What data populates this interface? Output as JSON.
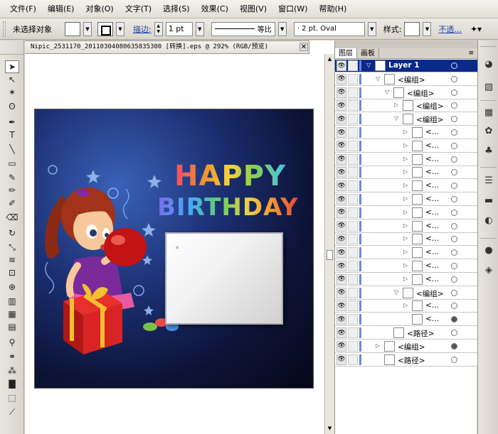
{
  "menubar": {
    "items": [
      "文件(F)",
      "编辑(E)",
      "对象(O)",
      "文字(T)",
      "选择(S)",
      "效果(C)",
      "视图(V)",
      "窗口(W)",
      "帮助(H)"
    ]
  },
  "controlbar": {
    "selection_label": "未选择对象",
    "stroke_label": "描边:",
    "stroke_weight": "1 pt",
    "line_style": "等比",
    "brush": "· 2 pt. Oval",
    "style_label": "样式:",
    "opacity_link": "不透..."
  },
  "document": {
    "tab_title": "Nipic_2531170_20110304080635835300 [转换].eps @ 292% (RGB/预览)"
  },
  "artwork": {
    "line1": "HAPPY",
    "line2": "BIRTHDAY"
  },
  "panel": {
    "tabs": [
      "图层",
      "画板"
    ],
    "active_tab": "图层",
    "menu_icon": "≡"
  },
  "layers": [
    {
      "name": "Layer 1",
      "indent": 0,
      "tri": "down",
      "selected": true,
      "target": "empty"
    },
    {
      "name": "<编组>",
      "indent": 1,
      "tri": "down",
      "selected": false,
      "target": "empty"
    },
    {
      "name": "<编组>",
      "indent": 2,
      "tri": "down",
      "selected": false,
      "target": "empty"
    },
    {
      "name": "<编组>",
      "indent": 3,
      "tri": "right",
      "selected": false,
      "target": "empty"
    },
    {
      "name": "<编组>",
      "indent": 3,
      "tri": "down",
      "selected": false,
      "target": "empty"
    },
    {
      "name": "<...",
      "indent": 4,
      "tri": "right",
      "selected": false,
      "target": "empty"
    },
    {
      "name": "<...",
      "indent": 4,
      "tri": "right",
      "selected": false,
      "target": "empty"
    },
    {
      "name": "<...",
      "indent": 4,
      "tri": "right",
      "selected": false,
      "target": "empty"
    },
    {
      "name": "<...",
      "indent": 4,
      "tri": "right",
      "selected": false,
      "target": "empty"
    },
    {
      "name": "<...",
      "indent": 4,
      "tri": "right",
      "selected": false,
      "target": "empty"
    },
    {
      "name": "<...",
      "indent": 4,
      "tri": "right",
      "selected": false,
      "target": "empty"
    },
    {
      "name": "<...",
      "indent": 4,
      "tri": "right",
      "selected": false,
      "target": "empty"
    },
    {
      "name": "<...",
      "indent": 4,
      "tri": "right",
      "selected": false,
      "target": "empty"
    },
    {
      "name": "<...",
      "indent": 4,
      "tri": "right",
      "selected": false,
      "target": "empty"
    },
    {
      "name": "<...",
      "indent": 4,
      "tri": "right",
      "selected": false,
      "target": "empty"
    },
    {
      "name": "<...",
      "indent": 4,
      "tri": "right",
      "selected": false,
      "target": "empty"
    },
    {
      "name": "<...",
      "indent": 4,
      "tri": "right",
      "selected": false,
      "target": "empty"
    },
    {
      "name": "<编组>",
      "indent": 3,
      "tri": "down",
      "selected": false,
      "target": "empty"
    },
    {
      "name": "<...",
      "indent": 4,
      "tri": "right",
      "selected": false,
      "target": "empty"
    },
    {
      "name": "<...",
      "indent": 4,
      "tri": "",
      "selected": false,
      "target": "filled"
    },
    {
      "name": "<路径>",
      "indent": 2,
      "tri": "",
      "selected": false,
      "target": "empty"
    },
    {
      "name": "<编组>",
      "indent": 1,
      "tri": "right",
      "selected": false,
      "target": "filled"
    },
    {
      "name": "<路径>",
      "indent": 1,
      "tri": "",
      "selected": false,
      "target": "empty"
    }
  ],
  "tools": [
    {
      "icon": "selection-tool-icon",
      "glyph": "➤"
    },
    {
      "icon": "direct-selection-tool-icon",
      "glyph": "↖"
    },
    {
      "icon": "magic-wand-tool-icon",
      "glyph": "✶"
    },
    {
      "icon": "lasso-tool-icon",
      "glyph": "ʘ"
    },
    {
      "icon": "pen-tool-icon",
      "glyph": "✒"
    },
    {
      "icon": "type-tool-icon",
      "glyph": "T"
    },
    {
      "icon": "line-tool-icon",
      "glyph": "╲"
    },
    {
      "icon": "rectangle-tool-icon",
      "glyph": "▭"
    },
    {
      "icon": "paintbrush-tool-icon",
      "glyph": "✎"
    },
    {
      "icon": "pencil-tool-icon",
      "glyph": "✏"
    },
    {
      "icon": "blob-brush-tool-icon",
      "glyph": "✐"
    },
    {
      "icon": "eraser-tool-icon",
      "glyph": "⌫"
    },
    {
      "icon": "rotate-tool-icon",
      "glyph": "↻"
    },
    {
      "icon": "scale-tool-icon",
      "glyph": "⤡"
    },
    {
      "icon": "warp-tool-icon",
      "glyph": "≋"
    },
    {
      "icon": "free-transform-tool-icon",
      "glyph": "⊡"
    },
    {
      "icon": "shape-builder-tool-icon",
      "glyph": "⊕"
    },
    {
      "icon": "graph-tool-icon",
      "glyph": "▥"
    },
    {
      "icon": "mesh-tool-icon",
      "glyph": "▦"
    },
    {
      "icon": "gradient-tool-icon",
      "glyph": "▤"
    },
    {
      "icon": "eyedropper-tool-icon",
      "glyph": "⚲"
    },
    {
      "icon": "blend-tool-icon",
      "glyph": "⚭"
    },
    {
      "icon": "symbol-sprayer-tool-icon",
      "glyph": "⁂"
    },
    {
      "icon": "column-graph-tool-icon",
      "glyph": "▇"
    },
    {
      "icon": "artboard-tool-icon",
      "glyph": "⬚"
    },
    {
      "icon": "slice-tool-icon",
      "glyph": "⟋"
    }
  ],
  "right_icons": [
    {
      "icon": "color-panel-icon",
      "glyph": "◕"
    },
    {
      "icon": "color-guide-icon",
      "glyph": "▨"
    },
    {
      "icon": "swatches-panel-icon",
      "glyph": "▦"
    },
    {
      "icon": "brushes-panel-icon",
      "glyph": "✿"
    },
    {
      "icon": "symbols-panel-icon",
      "glyph": "♣"
    },
    {
      "icon": "stroke-panel-icon",
      "glyph": "☰"
    },
    {
      "icon": "gradient-panel-icon",
      "glyph": "▬"
    },
    {
      "icon": "transparency-panel-icon",
      "glyph": "◐"
    },
    {
      "icon": "appearance-panel-icon",
      "glyph": "●"
    },
    {
      "icon": "graphic-styles-panel-icon",
      "glyph": "◈"
    }
  ]
}
